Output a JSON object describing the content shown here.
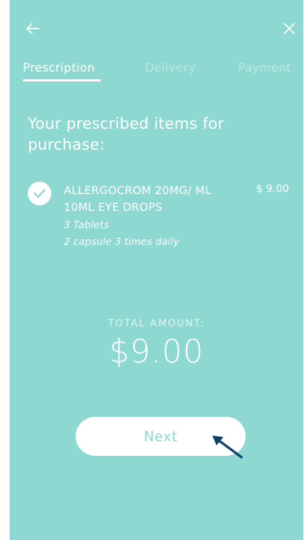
{
  "tabs": [
    {
      "label": "Prescription",
      "active": true
    },
    {
      "label": "Delivery",
      "active": false
    },
    {
      "label": "Payment",
      "active": false
    }
  ],
  "heading": "Your prescribed items for purchase:",
  "item": {
    "checked": true,
    "name": "ALLERGOCROM 20MG/ ML 10ML EYE DROPS",
    "quantity": "3 Tablets",
    "dosage": "2 capsule 3 times daily",
    "price": "$ 9.00"
  },
  "total": {
    "label": "TOTAL AMOUNT:",
    "amount": "$9.00"
  },
  "next_button": {
    "label": "Next"
  },
  "icons": {
    "back": "arrow-left-icon",
    "close": "close-icon",
    "check": "check-icon",
    "pointer": "mouse-pointer-icon"
  },
  "colors": {
    "background": "#8dd8d0",
    "text": "#ffffff",
    "inactive_tab": "#b7e9e3",
    "button_bg": "#ffffff",
    "button_text": "#8dd8d0",
    "pointer": "#0f3f6b"
  }
}
